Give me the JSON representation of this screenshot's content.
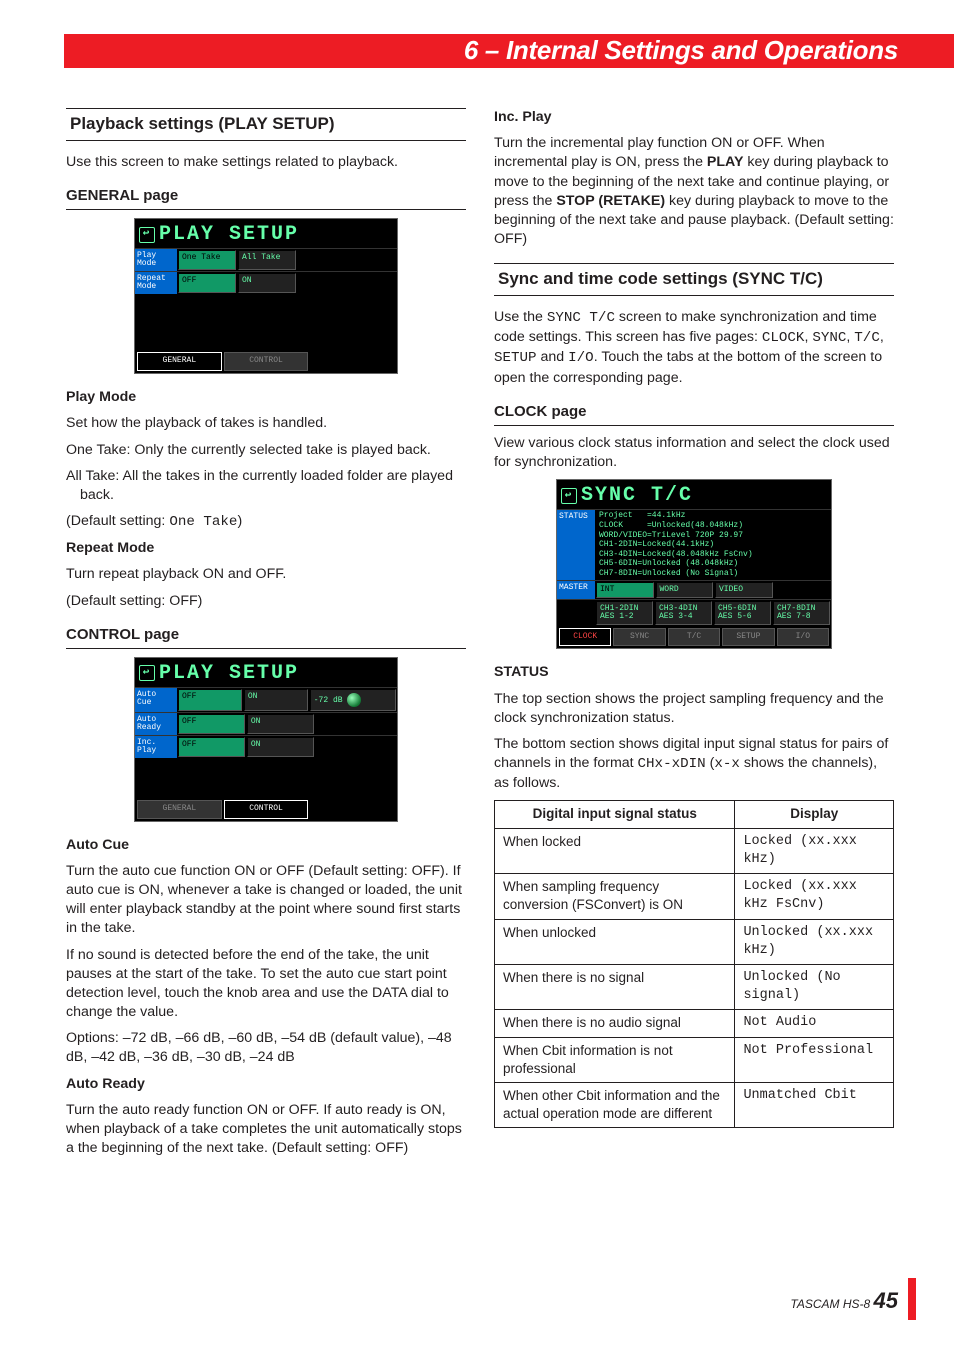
{
  "chapter_title": "6 – Internal Settings and Operations",
  "left": {
    "section1_title": "Playback settings (PLAY SETUP)",
    "section1_intro": "Use this screen to make settings related to playback.",
    "general_heading": "GENERAL page",
    "lcd1": {
      "title": "PLAY SETUP",
      "row1_label": "Play\nMode",
      "row1_a": "One\nTake",
      "row1_b": "All\nTake",
      "row2_label": "Repeat\nMode",
      "row2_a": "OFF",
      "row2_b": "ON",
      "tab1": "GENERAL",
      "tab2": "CONTROL"
    },
    "play_mode_h": "Play Mode",
    "play_mode_p1": "Set how the playback of takes is handled.",
    "play_mode_p2": "One Take: Only the currently selected take is played back.",
    "play_mode_p3": "All Take: All the takes in the currently loaded folder are played back.",
    "play_mode_p4a": "(Default setting: ",
    "play_mode_p4b": "One Take",
    "play_mode_p4c": ")",
    "repeat_h": "Repeat Mode",
    "repeat_p1": "Turn repeat playback ON and OFF.",
    "repeat_p2": "(Default setting: OFF)",
    "control_heading": "CONTROL page",
    "lcd2": {
      "title": "PLAY SETUP",
      "row1_label": "Auto\nCue",
      "row1_a": "OFF",
      "row1_b": "ON",
      "row1_c": "-72 dB",
      "row2_label": "Auto\nReady",
      "row2_a": "OFF",
      "row2_b": "ON",
      "row3_label": "Inc.\nPlay",
      "row3_a": "OFF",
      "row3_b": "ON",
      "tab1": "GENERAL",
      "tab2": "CONTROL"
    },
    "auto_cue_h": "Auto Cue",
    "auto_cue_p1": "Turn the auto cue function ON or OFF (Default setting: OFF). If auto cue is ON, whenever a take is changed or loaded, the unit will enter playback standby at the point where sound first starts in the take.",
    "auto_cue_p2": "If no sound is detected before the end of the take, the unit pauses at the start of the take. To set the auto cue start point detection level, touch the knob area and use the DATA dial to change the value.",
    "auto_cue_p3": "Options: –72 dB, –66 dB, –60 dB, –54 dB (default value), –48 dB, –42 dB, –36 dB, –30 dB, –24 dB",
    "auto_ready_h": "Auto Ready",
    "auto_ready_p1": "Turn the auto ready function ON or OFF. If auto ready is ON, when playback of a take completes the unit automatically stops a the beginning of the next take. (Default setting: OFF)"
  },
  "right": {
    "inc_play_h": "Inc. Play",
    "inc_play_p1a": "Turn the incremental play function ON or OFF. When incremental play is ON, press the ",
    "inc_play_p1b": "PLAY",
    "inc_play_p1c": " key during playback to move to the beginning of the next take and continue playing, or press the ",
    "inc_play_p1d": "STOP (RETAKE)",
    "inc_play_p1e": " key during playback to move to the beginning of the next take and pause playback. (Default setting: OFF)",
    "sync_heading": "Sync and time code settings (SYNC T/C)",
    "sync_p1a": "Use the ",
    "sync_p1b": "SYNC T/C",
    "sync_p1c": " screen to make synchronization and time code settings. This screen has five pages: ",
    "sync_p1d": "CLOCK",
    "sync_p1e": "SYNC",
    "sync_p1f": "T/C",
    "sync_p1g": "SETUP",
    "sync_p1h": "I/O",
    "sync_p1i": ". Touch the tabs at the bottom of the screen to open the corresponding page.",
    "clock_heading": "CLOCK page",
    "clock_p1": "View various clock status information and select the clock used for synchronization.",
    "lcd3": {
      "title": "SYNC T/C",
      "status_label": "STATUS",
      "status_lines": "Project   =44.1kHz\nCLOCK     =Unlocked(48.048kHz)\nWORD/VIDEO=TriLevel 720P 29.97\nCH1-2DIN=Locked(44.1kHz)\nCH3-4DIN=Locked(48.048kHz FsCnv)\nCH5-6DIN=Unlocked (48.048kHz)\nCH7-8DIN=Unlocked (No Signal)",
      "master_label": "MASTER",
      "m1": "INT",
      "m2": "WORD",
      "m3": "VIDEO",
      "m4": "",
      "m5": "CH1-2DIN\nAES 1-2",
      "m6": "CH3-4DIN\nAES 3-4",
      "m7": "CH5-6DIN\nAES 5-6",
      "m8": "CH7-8DIN\nAES 7-8",
      "t1": "CLOCK",
      "t2": "SYNC",
      "t3": "T/C",
      "t4": "SETUP",
      "t5": "I/O"
    },
    "status_h": "STATUS",
    "status_p1": "The top section shows the project sampling frequency and the clock synchronization status.",
    "status_p2a": "The bottom section shows digital input signal status for pairs of channels in the format ",
    "status_p2b": "CHx-xDIN",
    "status_p2c": " (",
    "status_p2d": "x-x",
    "status_p2e": " shows the channels), as follows.",
    "table": {
      "h1": "Digital input signal status",
      "h2": "Display",
      "rows": [
        [
          "When locked",
          "Locked (xx.xxx kHz)"
        ],
        [
          "When sampling frequency conversion (FSConvert) is ON",
          "Locked (xx.xxx kHz FsCnv)"
        ],
        [
          "When unlocked",
          "Unlocked (xx.xxx kHz)"
        ],
        [
          "When there is no signal",
          "Unlocked (No signal)"
        ],
        [
          "When there is no audio signal",
          "Not Audio"
        ],
        [
          "When Cbit information is not professional",
          "Not Professional"
        ],
        [
          "When other Cbit information and the actual operation mode are different",
          "Unmatched Cbit"
        ]
      ]
    }
  },
  "footer_model": "TASCAM  HS-8",
  "footer_page": "45"
}
